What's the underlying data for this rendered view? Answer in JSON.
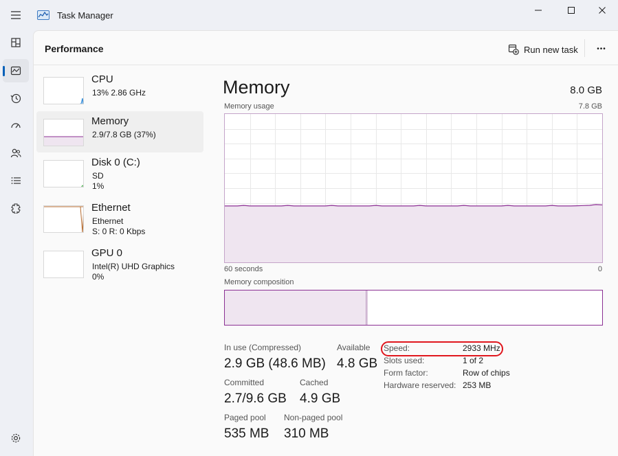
{
  "window": {
    "title": "Task Manager"
  },
  "nav": {
    "items": [
      {
        "icon": "hamburger-icon"
      },
      {
        "icon": "processes-icon"
      },
      {
        "icon": "performance-icon",
        "active": true
      },
      {
        "icon": "history-icon"
      },
      {
        "icon": "startup-icon"
      },
      {
        "icon": "users-icon"
      },
      {
        "icon": "details-icon"
      },
      {
        "icon": "services-icon"
      }
    ],
    "settings_icon": "gear-icon"
  },
  "header": {
    "title": "Performance",
    "run_new_task": "Run new task",
    "more": "•••"
  },
  "devices": [
    {
      "name": "CPU",
      "line1": "13%  2.86 GHz",
      "line2": "",
      "graph_color": "#1a7fd4",
      "value": 0.13
    },
    {
      "name": "Memory",
      "line1": "2.9/7.8 GB (37%)",
      "line2": "",
      "graph_color": "#8b2f93",
      "value": 0.37,
      "active": true
    },
    {
      "name": "Disk 0 (C:)",
      "line1": "SD",
      "line2": "1%",
      "graph_color": "#4caf50",
      "value": 0.01
    },
    {
      "name": "Ethernet",
      "line1": "Ethernet",
      "line2": "S: 0  R: 0 Kbps",
      "graph_color": "#b56a2e",
      "value": 0.0
    },
    {
      "name": "GPU 0",
      "line1": "Intel(R) UHD Graphics",
      "line2": "0%",
      "graph_color": "#1a7fd4",
      "value": 0.0
    }
  ],
  "memory": {
    "title": "Memory",
    "total": "8.0 GB",
    "usage_label": "Memory usage",
    "usage_max": "7.8 GB",
    "time_span": "60 seconds",
    "time_zero": "0",
    "composition_label": "Memory composition",
    "usage_fraction": 0.37,
    "in_use_fraction": 0.375,
    "accent": "#8b2f93",
    "stats": {
      "in_use_label": "In use (Compressed)",
      "in_use_value": "2.9 GB (48.6 MB)",
      "available_label": "Available",
      "available_value": "4.8 GB",
      "committed_label": "Committed",
      "committed_value": "2.7/9.6 GB",
      "cached_label": "Cached",
      "cached_value": "4.9 GB",
      "paged_label": "Paged pool",
      "paged_value": "535 MB",
      "nonpaged_label": "Non-paged pool",
      "nonpaged_value": "310 MB"
    },
    "details": [
      {
        "key": "Speed:",
        "value": "2933 MHz",
        "highlighted": true
      },
      {
        "key": "Slots used:",
        "value": "1 of 2"
      },
      {
        "key": "Form factor:",
        "value": "Row of chips"
      },
      {
        "key": "Hardware reserved:",
        "value": "253 MB"
      }
    ]
  }
}
